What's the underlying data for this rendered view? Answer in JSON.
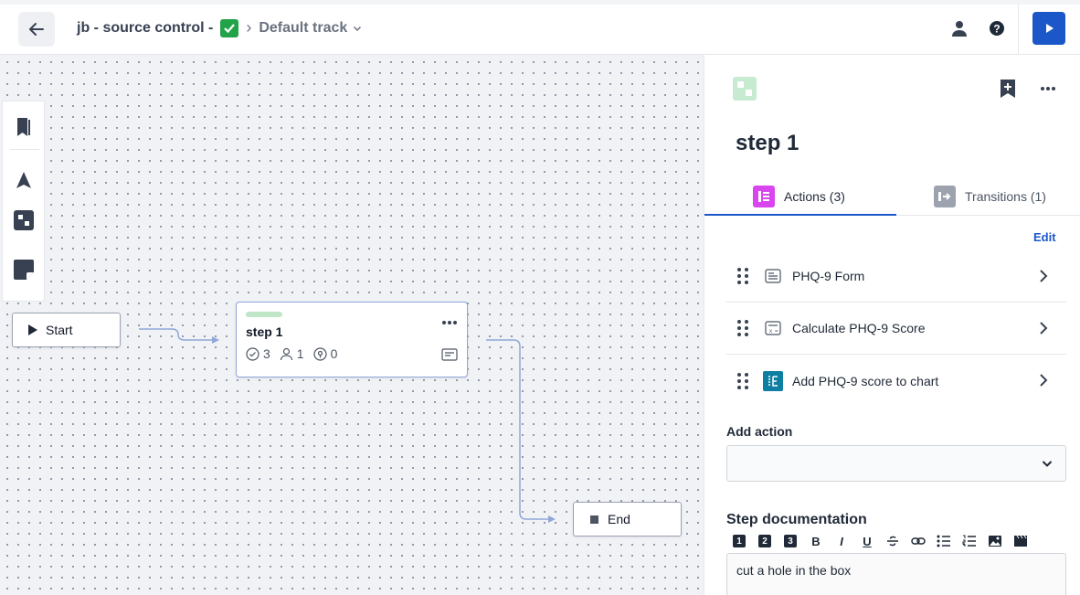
{
  "header": {
    "workflow_name": "jb - source control -",
    "track": "Default track"
  },
  "canvas": {
    "start_label": "Start",
    "end_label": "End",
    "step": {
      "title": "step 1",
      "actions_count": "3",
      "stakeholders_count": "1",
      "transitions_count": "0"
    }
  },
  "panel": {
    "title": "step 1",
    "tabs": [
      {
        "label": "Actions (3)"
      },
      {
        "label": "Transitions (1)"
      }
    ],
    "edit_label": "Edit",
    "actions": [
      {
        "label": "PHQ-9 Form",
        "icon": "form-icon"
      },
      {
        "label": "Calculate PHQ-9 Score",
        "icon": "calculator-icon"
      },
      {
        "label": "Add PHQ-9 score to chart",
        "icon": "chart-icon"
      }
    ],
    "add_action_label": "Add action",
    "add_action_value": "",
    "doc_label": "Step documentation",
    "doc_toolbar": [
      "1",
      "2",
      "3",
      "B",
      "I",
      "U"
    ],
    "doc_text": "cut a hole in the box"
  },
  "colors": {
    "accent": "#1b57c9",
    "step_bar": "#bfe6c6",
    "actions_tab_icon": "#d946ef",
    "canvas_bg": "#f0f2f6"
  }
}
